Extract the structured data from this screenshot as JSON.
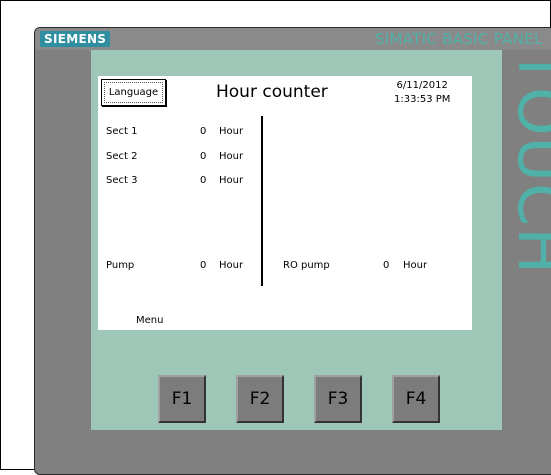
{
  "device": {
    "brand": "SIEMENS",
    "model": "SIMATIC BASIC PANEL",
    "side_label": "TOUCH",
    "colors": {
      "bezel": "#808080",
      "accent_green": "#9fc7b8",
      "brand_badge": "#2f8fa0",
      "model_text": "#4fb1a8"
    }
  },
  "screen": {
    "language_button": "Language",
    "title": "Hour counter",
    "date": "6/11/2012",
    "time": "1:33:53 PM",
    "sections": [
      {
        "label": "Sect 1",
        "value": "0",
        "unit": "Hour"
      },
      {
        "label": "Sect 2",
        "value": "0",
        "unit": "Hour"
      },
      {
        "label": "Sect 3",
        "value": "0",
        "unit": "Hour"
      }
    ],
    "pump": {
      "label": "Pump",
      "value": "0",
      "unit": "Hour"
    },
    "ro_pump": {
      "label": "RO pump",
      "value": "0",
      "unit": "Hour"
    },
    "menu_label": "Menu"
  },
  "function_keys": [
    "F1",
    "F2",
    "F3",
    "F4"
  ]
}
